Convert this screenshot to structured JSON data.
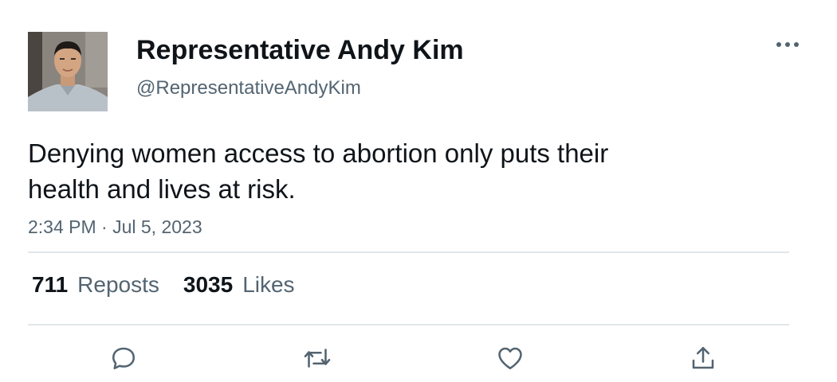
{
  "author": {
    "display_name": "Representative Andy Kim",
    "handle": "@RepresentativeAndyKim",
    "avatar_icon": "profile-photo"
  },
  "tweet": {
    "text": "Denying women access to abortion only puts their health and lives at risk.",
    "timestamp": "2:34 PM · Jul 5, 2023"
  },
  "stats": {
    "reposts_count": "711",
    "reposts_label": "Reposts",
    "likes_count": "3035",
    "likes_label": "Likes"
  },
  "actions": {
    "reply_icon": "reply-icon",
    "repost_icon": "repost-icon",
    "like_icon": "heart-icon",
    "share_icon": "share-icon",
    "more_icon": "more-icon"
  },
  "colors": {
    "text_primary": "#0f1419",
    "text_secondary": "#536471",
    "divider": "#e1e6e9"
  }
}
